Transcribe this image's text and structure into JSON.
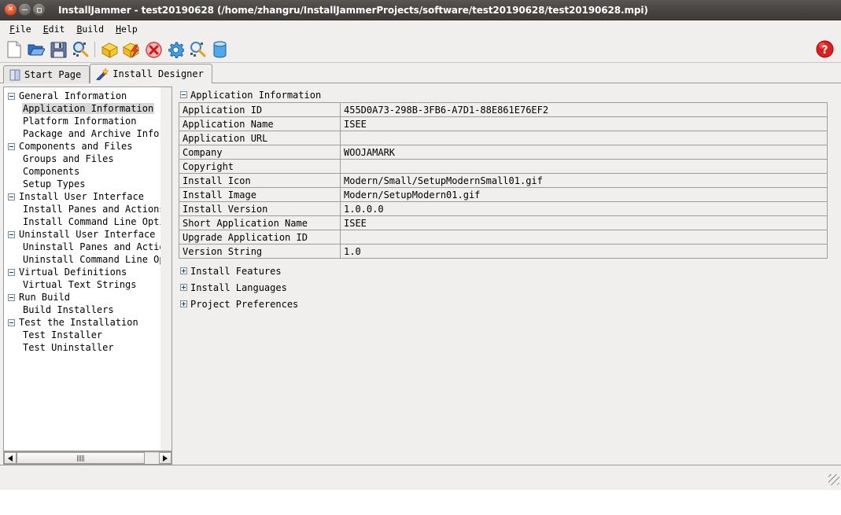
{
  "window": {
    "title": "InstallJammer - test20190628 (/home/zhangru/InstallJammerProjects/software/test20190628/test20190628.mpi)",
    "controls": [
      {
        "name": "close",
        "glyph": "×"
      },
      {
        "name": "minimize",
        "glyph": ""
      },
      {
        "name": "maximize",
        "glyph": ""
      }
    ]
  },
  "menubar": {
    "items": [
      {
        "label": "File",
        "mnemonic": "F",
        "rest": "ile"
      },
      {
        "label": "Edit",
        "mnemonic": "E",
        "rest": "dit"
      },
      {
        "label": "Build",
        "mnemonic": "B",
        "rest": "uild"
      },
      {
        "label": "Help",
        "mnemonic": "H",
        "rest": "elp"
      }
    ]
  },
  "toolbar": {
    "buttons": [
      {
        "name": "new-project-icon",
        "tip": "New Project"
      },
      {
        "name": "open-project-icon",
        "tip": "Open Project"
      },
      {
        "name": "save-project-icon",
        "tip": "Save Project"
      },
      {
        "name": "search-project-icon",
        "tip": "Find"
      },
      {
        "name": "separator",
        "tip": ""
      },
      {
        "name": "build-package-icon",
        "tip": "Build"
      },
      {
        "name": "quick-build-icon",
        "tip": "Quick Build"
      },
      {
        "name": "stop-build-icon",
        "tip": "Stop Build"
      },
      {
        "name": "preferences-gear-icon",
        "tip": "Preferences"
      },
      {
        "name": "inspect-icon",
        "tip": "Inspect"
      },
      {
        "name": "database-icon",
        "tip": "Database"
      }
    ],
    "help_button": {
      "name": "help-icon",
      "tip": "Help"
    }
  },
  "tabs": [
    {
      "label": "Start Page",
      "icon": "book-icon",
      "active": false
    },
    {
      "label": "Install Designer",
      "icon": "wand-icon",
      "active": true
    }
  ],
  "sidebar": {
    "nodes": [
      {
        "label": "General Information",
        "type": "parent",
        "expanded": true,
        "selected": false
      },
      {
        "label": "Application Information",
        "type": "child",
        "selected": true
      },
      {
        "label": "Platform Information",
        "type": "child",
        "selected": false
      },
      {
        "label": "Package and Archive Informat",
        "type": "child",
        "selected": false
      },
      {
        "label": "Components and Files",
        "type": "parent",
        "expanded": true,
        "selected": false
      },
      {
        "label": "Groups and Files",
        "type": "child",
        "selected": false
      },
      {
        "label": "Components",
        "type": "child",
        "selected": false
      },
      {
        "label": "Setup Types",
        "type": "child",
        "selected": false
      },
      {
        "label": "Install User Interface",
        "type": "parent",
        "expanded": true,
        "selected": false
      },
      {
        "label": "Install Panes and Actions",
        "type": "child",
        "selected": false
      },
      {
        "label": "Install Command Line Options",
        "type": "child",
        "selected": false
      },
      {
        "label": "Uninstall User Interface",
        "type": "parent",
        "expanded": true,
        "selected": false
      },
      {
        "label": "Uninstall Panes and Actions",
        "type": "child",
        "selected": false
      },
      {
        "label": "Uninstall Command Line Optic",
        "type": "child",
        "selected": false
      },
      {
        "label": "Virtual Definitions",
        "type": "parent",
        "expanded": true,
        "selected": false
      },
      {
        "label": "Virtual Text Strings",
        "type": "child",
        "selected": false
      },
      {
        "label": "Run Build",
        "type": "parent",
        "expanded": true,
        "selected": false
      },
      {
        "label": "Build Installers",
        "type": "child",
        "selected": false
      },
      {
        "label": "Test the Installation",
        "type": "parent",
        "expanded": true,
        "selected": false
      },
      {
        "label": "Test Installer",
        "type": "child",
        "selected": false
      },
      {
        "label": "Test Uninstaller",
        "type": "child",
        "selected": false
      }
    ],
    "hscrollbar": {
      "left_arrow": "◀",
      "right_arrow": "▶"
    }
  },
  "main": {
    "section_title": "Application Information",
    "rows": [
      {
        "key": "Application ID",
        "value": "455D0A73-298B-3FB6-A7D1-88E861E76EF2"
      },
      {
        "key": "Application Name",
        "value": "ISEE"
      },
      {
        "key": "Application URL",
        "value": ""
      },
      {
        "key": "Company",
        "value": "WOOJAMARK"
      },
      {
        "key": "Copyright",
        "value": ""
      },
      {
        "key": "Install Icon",
        "value": "Modern/Small/SetupModernSmall01.gif"
      },
      {
        "key": "Install Image",
        "value": "Modern/SetupModern01.gif"
      },
      {
        "key": "Install Version",
        "value": "1.0.0.0"
      },
      {
        "key": "Short Application Name",
        "value": "ISEE"
      },
      {
        "key": "Upgrade Application ID",
        "value": ""
      },
      {
        "key": "Version String",
        "value": "1.0"
      }
    ],
    "collapsed_sections": [
      {
        "label": "Install Features"
      },
      {
        "label": "Install Languages"
      },
      {
        "label": "Project Preferences"
      }
    ]
  },
  "colors": {
    "titlebar_bg": "#4a4644",
    "close_button": "#dd4814",
    "widget_bg": "#f0efee",
    "border": "#9c9996",
    "selection_bg": "#d8d8d8",
    "help_red": "#d01818"
  }
}
